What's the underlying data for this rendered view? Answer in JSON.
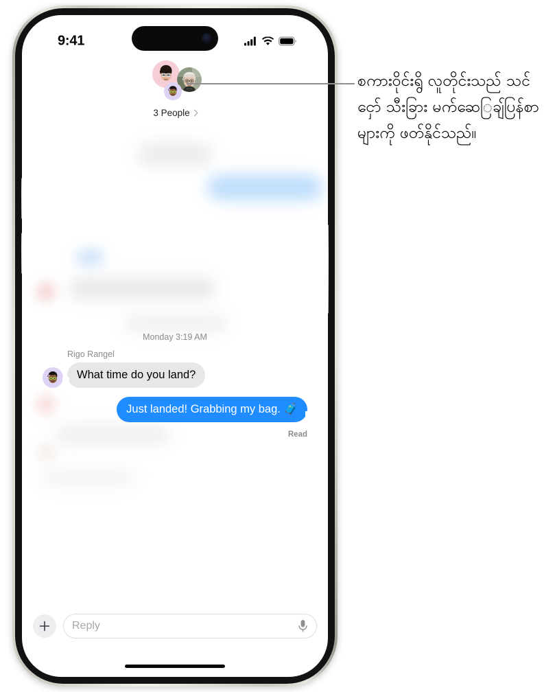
{
  "status_bar": {
    "time": "9:41",
    "cellular_icon": "cellular-bars-icon",
    "wifi_icon": "wifi-icon",
    "battery_icon": "battery-full-icon"
  },
  "chat_header": {
    "participants_label": "3 People",
    "chevron_icon": "chevron-right-icon",
    "avatars": [
      {
        "name": "memoji-avatar-pink",
        "bg": "#f7cdd6"
      },
      {
        "name": "photo-avatar-older-person",
        "bg": "#b8b4a6"
      },
      {
        "name": "memoji-avatar-lavender",
        "bg": "#ded3f5"
      }
    ]
  },
  "conversation": {
    "day_stamp": "Monday 3:19 AM",
    "messages": [
      {
        "sender": "Rigo Rangel",
        "text": "What time do you land?",
        "direction": "incoming",
        "avatar": "memoji-avatar-lavender"
      },
      {
        "sender": "",
        "text": "Just landed! Grabbing my bag. 🧳",
        "direction": "outgoing",
        "receipt": "Read"
      }
    ]
  },
  "input_bar": {
    "add_label": "+",
    "reply_placeholder": "Reply",
    "mic_icon": "microphone-icon"
  },
  "callout": {
    "text": "စကားဝိုင်းရွိ လူတိုင်းသည် သင်ငှော် သီးခြား မက်ဆေြချ်ပြန်စာများကို ဖတ်နိုင်သည်။"
  },
  "colors": {
    "imessage_blue": "#1f8cff",
    "incoming_gray": "#e7e7e9",
    "secondary_text": "#8b8b90",
    "callout_line": "#8e8e93"
  }
}
